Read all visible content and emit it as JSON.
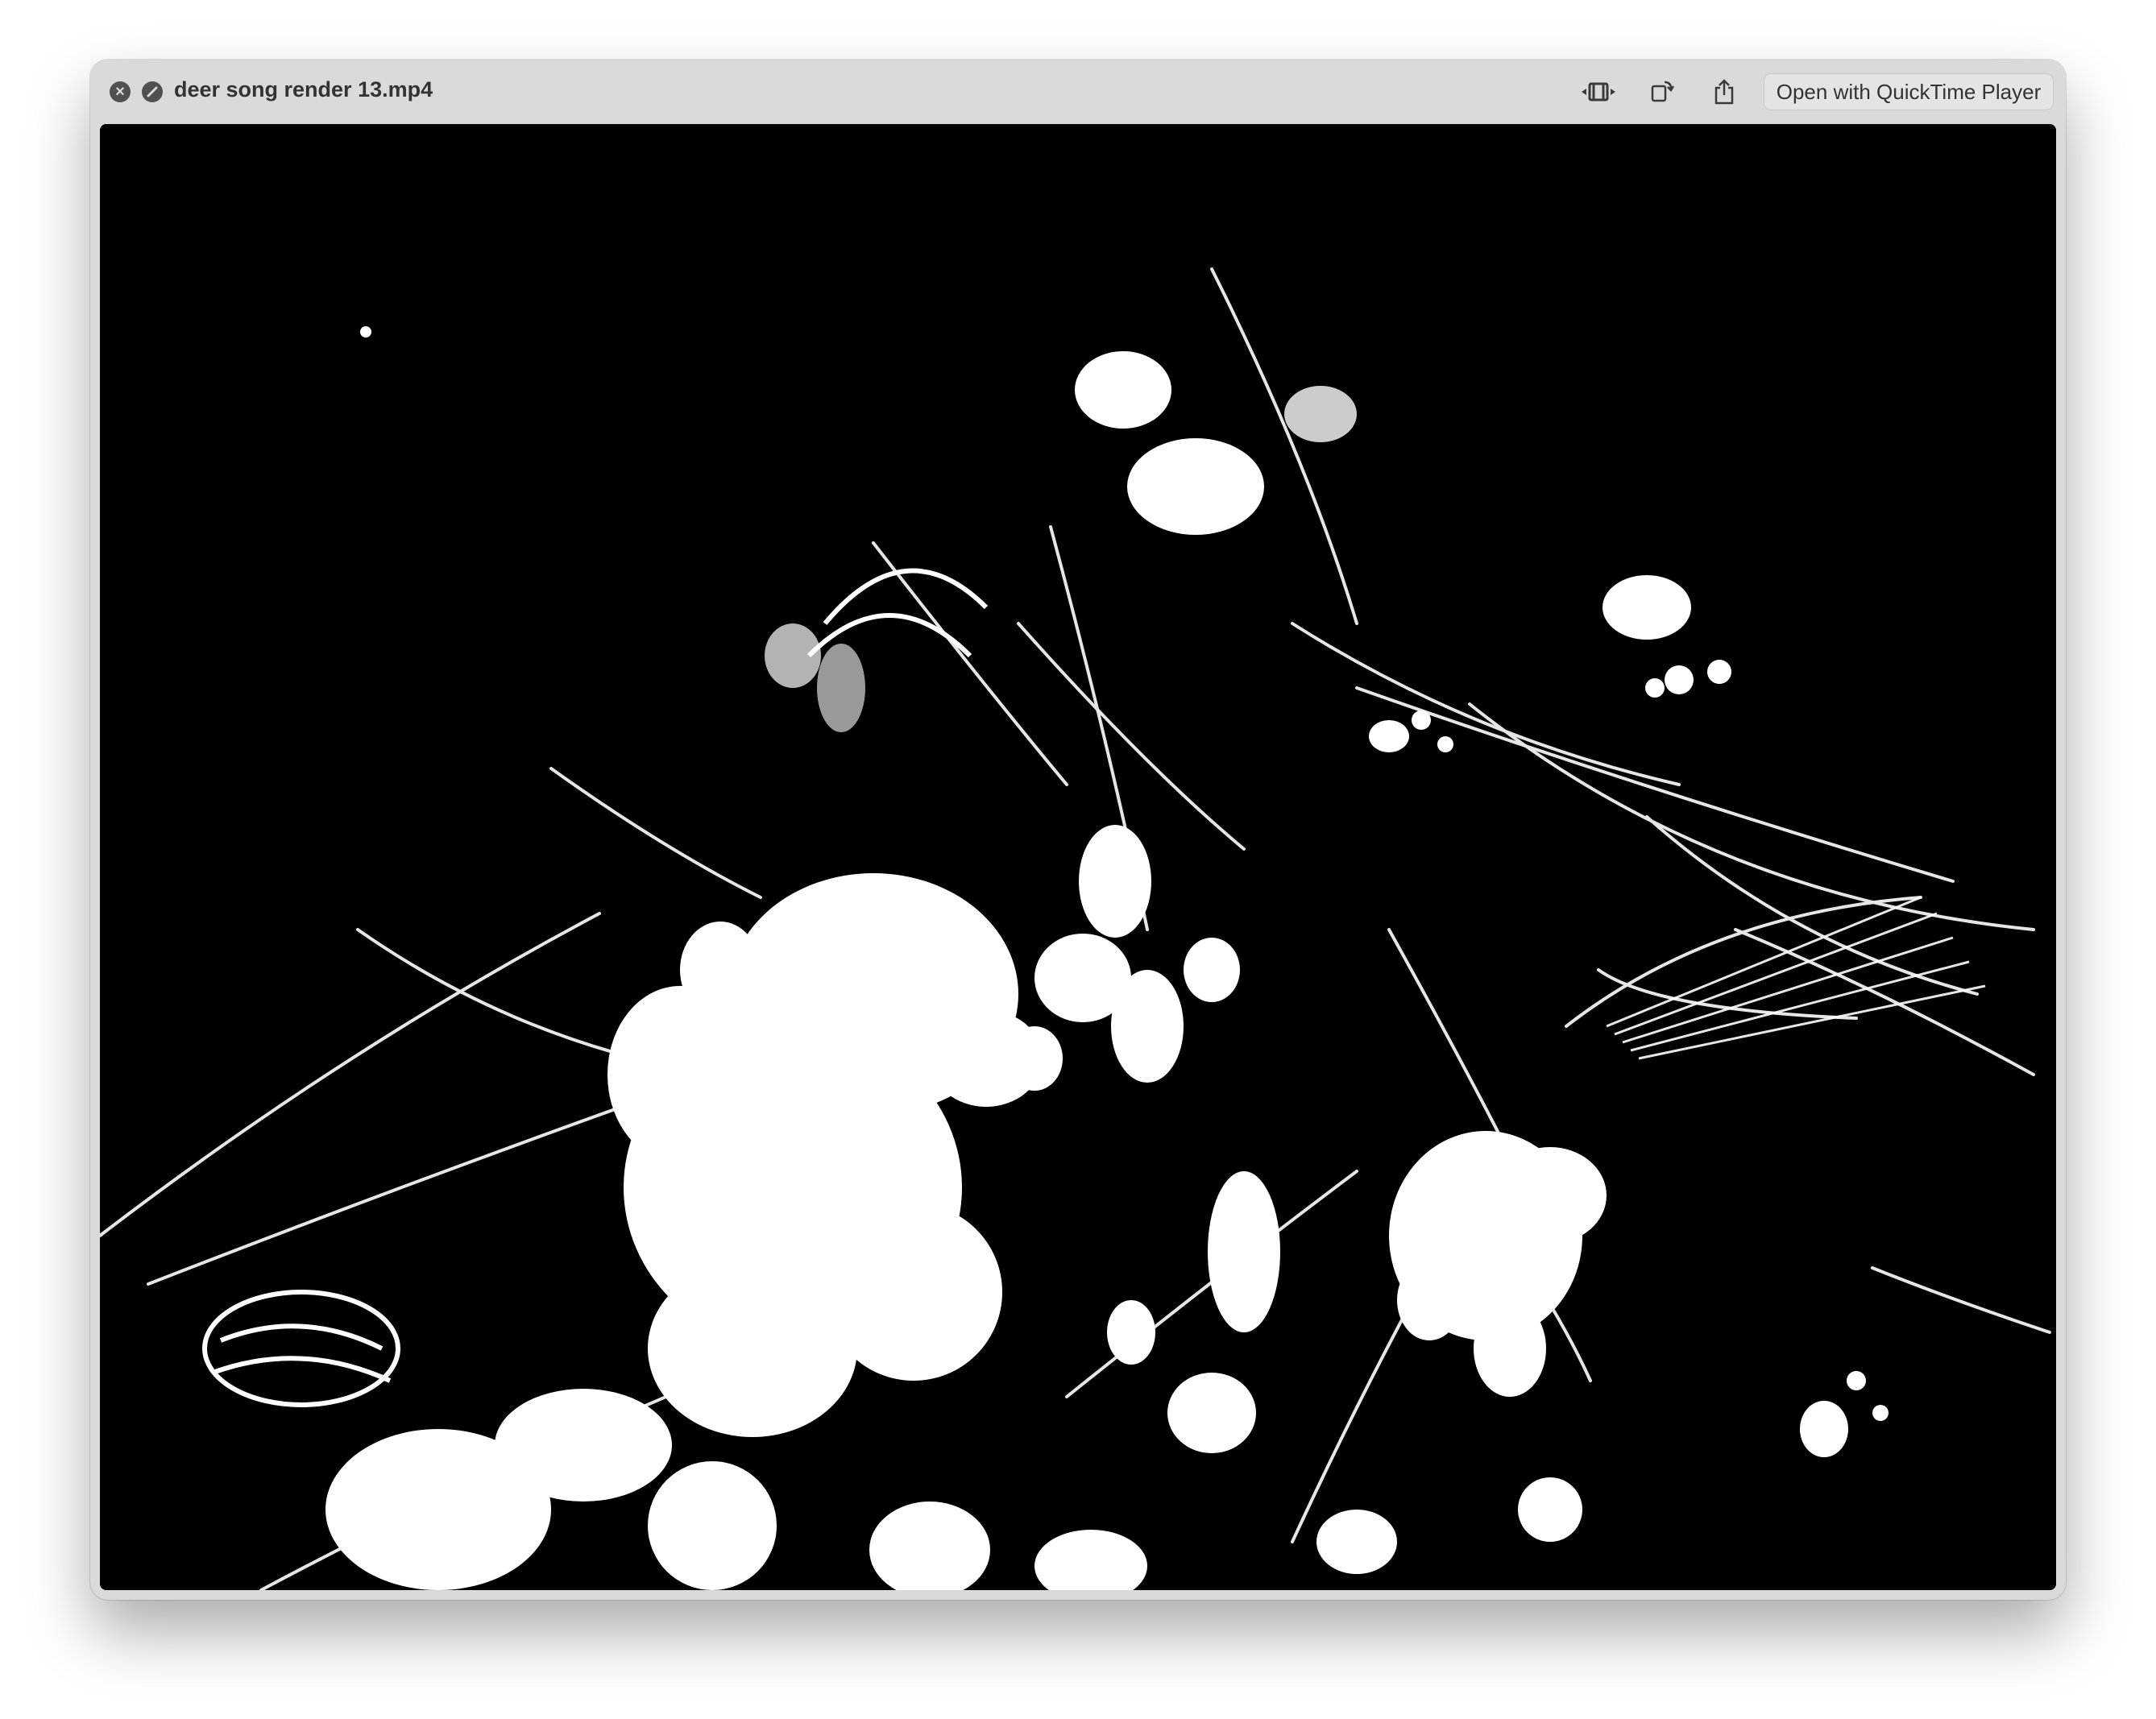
{
  "window": {
    "title": "deer song render 13.mp4",
    "open_with_label": "Open with QuickTime Player"
  },
  "icons": {
    "close": "close-icon",
    "clip": "clip-icon",
    "trim": "trim-icon",
    "rotate": "rotate-icon",
    "share": "share-icon"
  },
  "preview": {
    "description_kind": "video-frame",
    "colors": {
      "background": "#000000",
      "foreground": "#ffffff"
    }
  }
}
